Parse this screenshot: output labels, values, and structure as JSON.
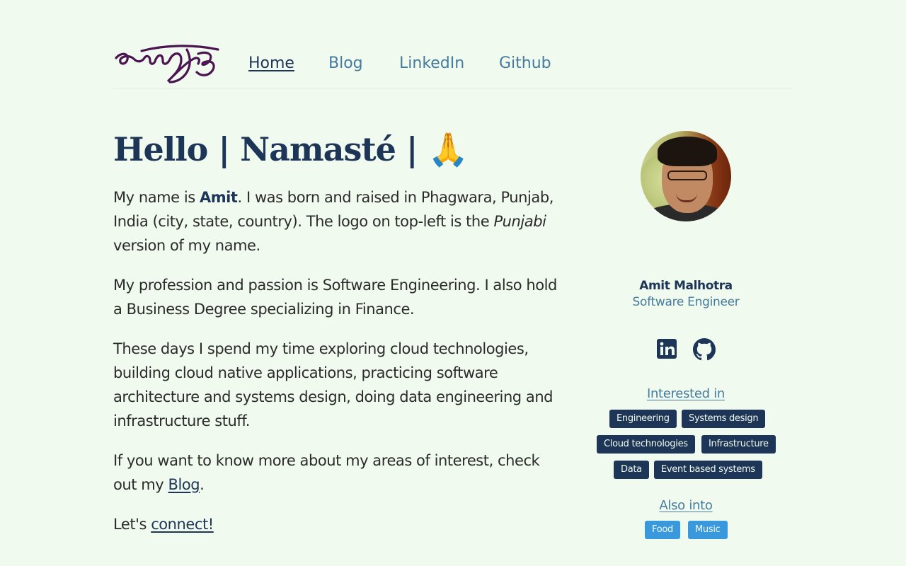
{
  "header": {
    "logo_alt": "ਅਮਿਤ",
    "nav": [
      {
        "label": "Home",
        "active": true
      },
      {
        "label": "Blog",
        "active": false
      },
      {
        "label": "LinkedIn",
        "active": false
      },
      {
        "label": "Github",
        "active": false
      }
    ]
  },
  "main": {
    "heading": "Hello | Namasté | 🙏",
    "para1": {
      "before": "My name is ",
      "name": "Amit",
      "middle": ". I was born and raised in Phagwara, Punjab, India (city, state, country). The logo on top-left is the ",
      "emph": "Punjabi",
      "after": " version of my name."
    },
    "para2": "My profession and passion is Software Engineering. I also hold a Business Degree specializing in Finance.",
    "para3": "These days I spend my time exploring cloud technologies, building cloud native applications, practicing software architecture and systems design, doing data engineering and infrastructure stuff.",
    "para4": {
      "before": "If you want to know more about my areas of interest, check out my ",
      "link": "Blog",
      "after": "."
    },
    "para5": {
      "before": "Let's ",
      "link": "connect!"
    }
  },
  "sidebar": {
    "name": "Amit Malhotra",
    "role": "Software Engineer",
    "social": [
      {
        "icon": "linkedin-icon"
      },
      {
        "icon": "github-icon"
      }
    ],
    "interested_title": "Interested in",
    "interested_tags": [
      "Engineering",
      "Systems design",
      "Cloud technologies",
      "Infrastructure",
      "Data",
      "Event based systems"
    ],
    "also_title": "Also into",
    "also_tags": [
      "Food",
      "Music"
    ]
  },
  "colors": {
    "background": "#f1faee",
    "primary": "#1d3557",
    "accent": "#457b9d",
    "tag_light": "#3a98dc",
    "logo": "#4a1550"
  }
}
